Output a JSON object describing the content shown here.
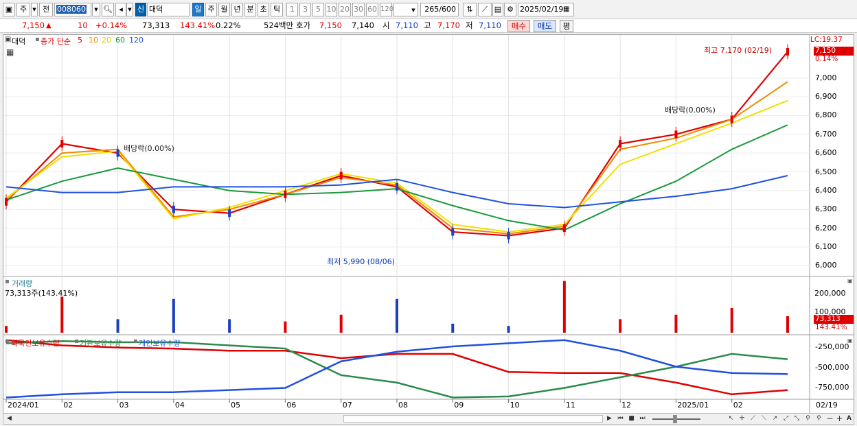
{
  "toolbar": {
    "type_label": "주",
    "prev_label": "전",
    "code": "008060",
    "mode_badge": "신",
    "stock_name": "대덕",
    "periods": [
      "일",
      "주",
      "월",
      "년",
      "분",
      "초",
      "틱"
    ],
    "active_period": "일",
    "intervals": [
      "1",
      "3",
      "5",
      "10",
      "20",
      "30",
      "60",
      "120"
    ],
    "count": "265",
    "count_max": "600",
    "date": "2025/02/19"
  },
  "quote": {
    "price": "7,150",
    "change": "10",
    "change_pct": "+0.14%",
    "volume": "73,313",
    "volume_ratio": "143.41%",
    "turnover_pct": "0.22%",
    "trade_value": "524백만",
    "ask_label": "호가",
    "ask": "7,150",
    "bid": "7,140",
    "open_label": "시",
    "open": "7,110",
    "high_label": "고",
    "high": "7,170",
    "low_label": "저",
    "low": "7,110",
    "buy_label": "매수",
    "sell_label": "매도",
    "eval_label": "평"
  },
  "price_panel": {
    "stock": "대덕",
    "ma_title": "종가 단순",
    "ma_periods": [
      "5",
      "10",
      "20",
      "60",
      "120"
    ],
    "ma_colors": [
      "#e00000",
      "#f08a00",
      "#f0e000",
      "#1a9a3a",
      "#2050e0"
    ],
    "lc_label": "LC:19.37",
    "price_tag": "7,150",
    "pct_tag": "0.14%",
    "y_ticks": [
      "7,000",
      "6,900",
      "6,800",
      "6,700",
      "6,600",
      "6,500",
      "6,400",
      "6,300",
      "6,200",
      "6,100",
      "6,000"
    ],
    "high_annotation": "최고 7,170 (02/19)",
    "low_annotation": "최저 5,990 (08/06)",
    "dividend_1": "배당락(0.00%)",
    "dividend_2": "배당락(0.00%)"
  },
  "volume_panel": {
    "title": "거래량",
    "summary": "73,313주(143.41%)",
    "y_ticks": [
      "200,000",
      "100,000"
    ],
    "vol_tag": "73,313",
    "vol_pct_tag": "143.41%"
  },
  "holding_panel": {
    "legend": [
      "외국인보유수량",
      "기관보유수량",
      "개인보유수량"
    ],
    "colors": [
      "#e00000",
      "#2a8a4a",
      "#2050e0"
    ],
    "y_ticks": [
      "-250,000",
      "-500,000",
      "-750,000"
    ]
  },
  "x_axis": {
    "labels": [
      "2024/01",
      "02",
      "03",
      "04",
      "05",
      "06",
      "07",
      "08",
      "09",
      "10",
      "11",
      "12",
      "2025/01",
      "02"
    ],
    "last_label": "02/19"
  },
  "chart_data": [
    {
      "type": "line",
      "title": "",
      "x": [
        "2024/01",
        "02",
        "03",
        "04",
        "05",
        "06",
        "07",
        "08",
        "09",
        "10",
        "11",
        "12",
        "2025/01",
        "02",
        "02/19"
      ],
      "series": [
        {
          "name": "5",
          "values": [
            6340,
            6650,
            6600,
            6300,
            6280,
            6380,
            6480,
            6420,
            6180,
            6160,
            6200,
            6650,
            6700,
            6780,
            7140
          ]
        },
        {
          "name": "10",
          "values": [
            6350,
            6600,
            6620,
            6260,
            6300,
            6380,
            6470,
            6430,
            6200,
            6170,
            6210,
            6620,
            6680,
            6780,
            6980
          ]
        },
        {
          "name": "20",
          "values": [
            6360,
            6580,
            6610,
            6250,
            6310,
            6400,
            6490,
            6440,
            6220,
            6180,
            6220,
            6540,
            6650,
            6760,
            6880
          ]
        },
        {
          "name": "60",
          "values": [
            6350,
            6450,
            6520,
            6460,
            6400,
            6380,
            6390,
            6410,
            6320,
            6240,
            6190,
            6330,
            6450,
            6620,
            6750
          ]
        },
        {
          "name": "120",
          "values": [
            6420,
            6390,
            6390,
            6420,
            6420,
            6420,
            6430,
            6460,
            6390,
            6330,
            6310,
            6340,
            6370,
            6410,
            6480
          ]
        }
      ],
      "ylim": [
        5950,
        7200
      ],
      "annotations": [
        "최고 7,170 (02/19)",
        "최저 5,990 (08/06)",
        "배당락(0.00%)"
      ]
    },
    {
      "type": "bar",
      "title": "거래량",
      "x": [
        "2024/01",
        "02",
        "03",
        "04",
        "05",
        "06",
        "07",
        "08",
        "09",
        "10",
        "11",
        "12",
        "2025/01",
        "02",
        "02/19"
      ],
      "values": [
        30000,
        160000,
        60000,
        150000,
        60000,
        50000,
        80000,
        150000,
        40000,
        30000,
        230000,
        60000,
        80000,
        110000,
        73313
      ],
      "ylim": [
        0,
        250000
      ]
    },
    {
      "type": "line",
      "x": [
        "2024/01",
        "02",
        "03",
        "04",
        "05",
        "06",
        "07",
        "08",
        "09",
        "10",
        "11",
        "12",
        "2025/01",
        "02",
        "02/19"
      ],
      "series": [
        {
          "name": "외국인보유수량",
          "values": [
            -250000,
            -300000,
            -320000,
            -330000,
            -350000,
            -350000,
            -420000,
            -380000,
            -380000,
            -550000,
            -560000,
            -560000,
            -650000,
            -760000,
            -720000
          ]
        },
        {
          "name": "기관보유수량",
          "values": [
            -280000,
            -260000,
            -270000,
            -270000,
            -300000,
            -330000,
            -580000,
            -650000,
            -790000,
            -780000,
            -700000,
            -600000,
            -500000,
            -380000,
            -430000
          ]
        },
        {
          "name": "개인보유수량",
          "values": [
            -790000,
            -760000,
            -740000,
            -740000,
            -720000,
            -700000,
            -450000,
            -360000,
            -310000,
            -280000,
            -250000,
            -350000,
            -500000,
            -560000,
            -570000
          ]
        }
      ],
      "ylim": [
        -800000,
        -200000
      ]
    }
  ]
}
